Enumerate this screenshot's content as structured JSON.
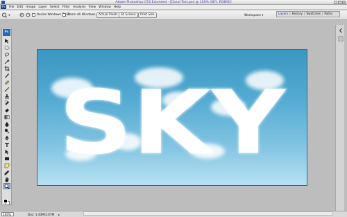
{
  "window": {
    "title": "Adobe Photoshop CS3 Extended - [Cloud Text.psd @ 100% (SKY, RGB/8)]",
    "buttons": [
      "_",
      "□",
      "×"
    ]
  },
  "menu": {
    "badge": "Ps",
    "items": [
      "File",
      "Edit",
      "Image",
      "Layer",
      "Select",
      "Filter",
      "Analysis",
      "View",
      "Window",
      "Help"
    ]
  },
  "options": {
    "resize_windows": "Resize Windows To Fit",
    "zoom_all": "Zoom All Windows",
    "actual_pixels": "Actual Pixels",
    "fit_screen": "Fit Screen",
    "print_size": "Print Size",
    "workspace": "Workspace",
    "workspace_arrow": "▾"
  },
  "palette": {
    "tabs": [
      "Layers",
      "History",
      "Swatches",
      "Paths"
    ]
  },
  "tools": {
    "logo": "Ps",
    "icons": [
      "move-icon",
      "marquee-icon",
      "lasso-icon",
      "magic-wand-icon",
      "crop-icon",
      "slice-icon",
      "healing-brush-icon",
      "brush-icon",
      "clone-stamp-icon",
      "history-brush-icon",
      "eraser-icon",
      "gradient-icon",
      "blur-icon",
      "dodge-icon",
      "pen-icon",
      "type-icon",
      "path-selection-icon",
      "rectangle-shape-icon",
      "notes-icon",
      "eyedropper-icon",
      "hand-icon",
      "zoom-icon"
    ],
    "selected_tool": "zoom-icon",
    "foreground_color": "#000000",
    "background_color": "#ffffff"
  },
  "document": {
    "text": "SKY",
    "sky_top_color": "#3b97c1",
    "sky_bottom_color": "#b6e0f1"
  },
  "status": {
    "zoom": "100%",
    "doc_info": "Doc: 1.43M/3.07M",
    "arrow": "▸"
  }
}
